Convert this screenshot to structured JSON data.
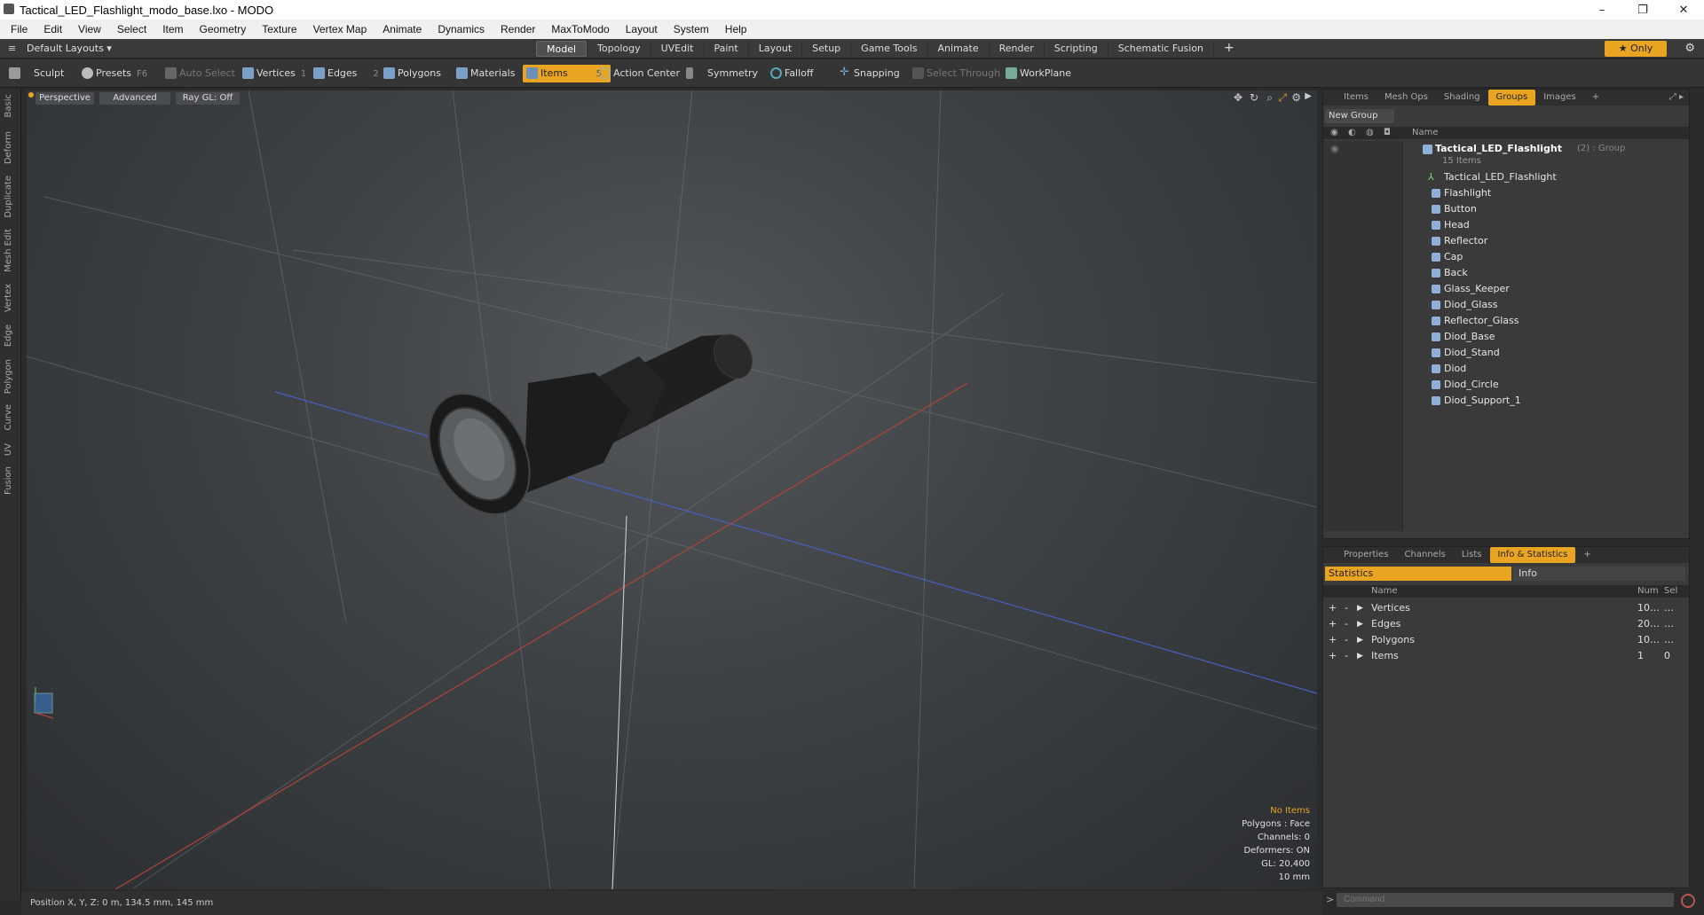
{
  "window": {
    "title": "Tactical_LED_Flashlight_modo_base.lxo - MODO",
    "minimize": "–",
    "maximize": "❐",
    "close": "✕"
  },
  "menu": [
    "File",
    "Edit",
    "View",
    "Select",
    "Item",
    "Geometry",
    "Texture",
    "Vertex Map",
    "Animate",
    "Dynamics",
    "Render",
    "MaxToModo",
    "Layout",
    "System",
    "Help"
  ],
  "layouts": {
    "label": "Default Layouts ▾"
  },
  "tabs": [
    "Model",
    "Topology",
    "UVEdit",
    "Paint",
    "Layout",
    "Setup",
    "Game Tools",
    "Animate",
    "Render",
    "Scripting",
    "Schematic Fusion"
  ],
  "tab_add": "+",
  "only_label": "★  Only",
  "toolbar": {
    "sculpt": "Sculpt",
    "presets": "Presets",
    "presets_key": "F6",
    "auto_select": "Auto Select",
    "vertices": "Vertices",
    "vertices_n": "1",
    "edges": "Edges",
    "edges_n": "2",
    "polygons": "Polygons",
    "materials": "Materials",
    "items": "Items",
    "items_n": "5",
    "action_center": "Action Center",
    "symmetry": "Symmetry",
    "falloff": "Falloff",
    "snapping": "Snapping",
    "select_through": "Select Through",
    "workplane": "WorkPlane"
  },
  "left_palette": [
    "Basic",
    "Deform",
    "Duplicate",
    "Mesh Edit",
    "Vertex",
    "Edge",
    "Polygon",
    "Curve",
    "UV",
    "Fusion"
  ],
  "viewport": {
    "perspective": "Perspective",
    "advanced": "Advanced",
    "raygl": "Ray GL: Off",
    "info": {
      "no_items": "No Items",
      "polygons": "Polygons : Face",
      "channels": "Channels: 0",
      "deformers": "Deformers: ON",
      "gl": "GL: 20,400",
      "scale": "10 mm"
    }
  },
  "status": {
    "position": "Position X, Y, Z:   0 m, 134.5 mm, 145 mm"
  },
  "top_panel": {
    "tabs": [
      "Items",
      "Mesh Ops",
      "Shading",
      "Groups",
      "Images"
    ],
    "active_tab": "Groups",
    "new_group": "New Group",
    "name_header": "Name",
    "group_name": "Tactical_LED_Flashlight",
    "group_suffix": "(2) : Group",
    "group_count": "15 Items",
    "items": [
      "Tactical_LED_Flashlight",
      "Flashlight",
      "Button",
      "Head",
      "Reflector",
      "Cap",
      "Back",
      "Glass_Keeper",
      "Diod_Glass",
      "Reflector_Glass",
      "Diod_Base",
      "Diod_Stand",
      "Diod",
      "Diod_Circle",
      "Diod_Support_1"
    ]
  },
  "bottom_panel": {
    "tabs": [
      "Properties",
      "Channels",
      "Lists",
      "Info & Statistics"
    ],
    "active_tab": "Info & Statistics",
    "subtabs": [
      "Statistics",
      "Info"
    ],
    "headers": {
      "name": "Name",
      "num": "Num",
      "sel": "Sel"
    },
    "rows": [
      {
        "name": "Vertices",
        "num": "10…",
        "sel": "…"
      },
      {
        "name": "Edges",
        "num": "20…",
        "sel": "…"
      },
      {
        "name": "Polygons",
        "num": "10…",
        "sel": "…"
      },
      {
        "name": "Items",
        "num": "1",
        "sel": "0"
      }
    ]
  },
  "command": {
    "placeholder": "Command",
    "prompt": ">"
  }
}
